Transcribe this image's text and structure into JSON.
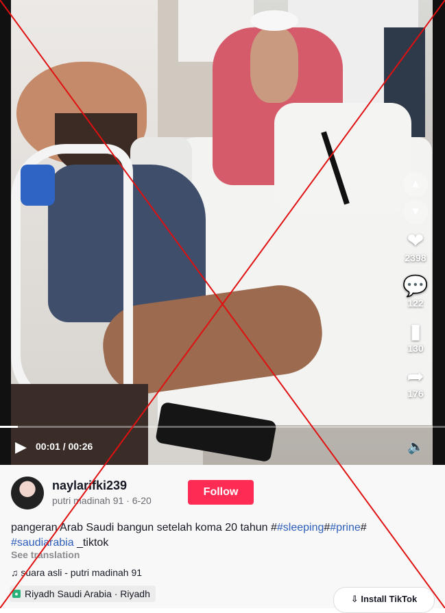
{
  "video": {
    "actions": {
      "likes": "2398",
      "comments": "122",
      "saves": "130",
      "shares": "176"
    },
    "time": "00:01 / 00:26",
    "progress_fraction": 0.04
  },
  "post": {
    "username": "naylarifki239",
    "display_name": "putri madinah 91",
    "date": "6-20",
    "follow_label": "Follow",
    "caption_text": "pangeran Arab Saudi bangun setelah koma 20 tahun #",
    "tags": [
      "#sleeping",
      "#prine",
      "#saudiarabia"
    ],
    "caption_suffix": " _tiktok",
    "see_translation": "See translation",
    "music": "suara asli - putri madinah 91",
    "location": "Riyadh Saudi Arabia · Riyadh",
    "install_label": "Install TikTok"
  },
  "colors": {
    "follow": "#fe2c55",
    "hashtag": "#2b5db9",
    "x_overlay": "#e01010"
  }
}
